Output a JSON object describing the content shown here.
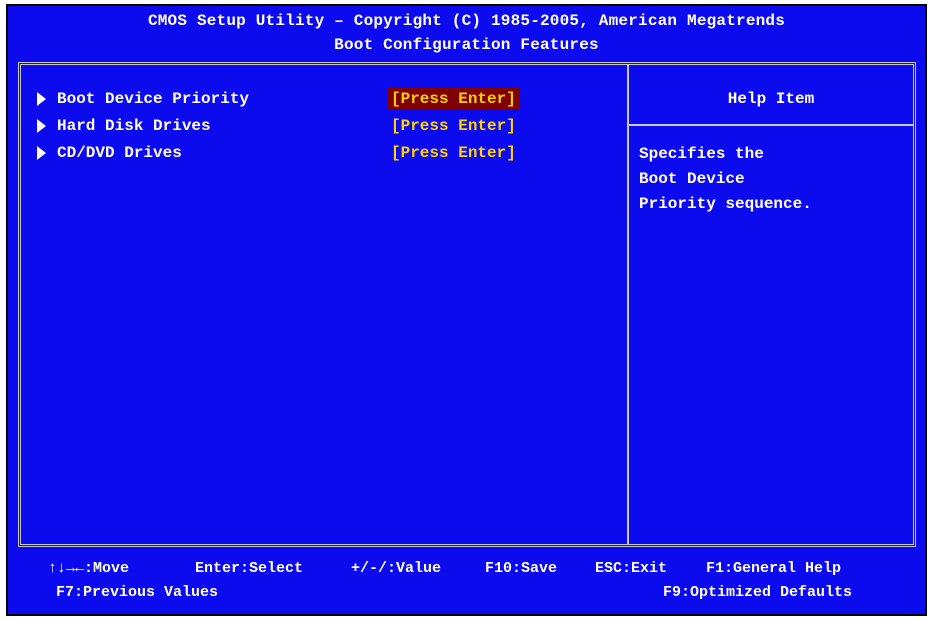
{
  "header": {
    "line1": "CMOS Setup Utility – Copyright (C) 1985-2005, American Megatrends",
    "line2": "Boot Configuration Features"
  },
  "items": [
    {
      "label": "Boot Device Priority",
      "value": "[Press Enter]",
      "selected": true
    },
    {
      "label": "Hard Disk Drives",
      "value": "[Press Enter]",
      "selected": false
    },
    {
      "label": "CD/DVD Drives",
      "value": "[Press Enter]",
      "selected": false
    }
  ],
  "help": {
    "title": "Help Item",
    "lines": [
      "Specifies the",
      "Boot Device",
      "Priority sequence."
    ]
  },
  "footer": {
    "move": "↑↓→←:Move",
    "select": "Enter:Select",
    "value": "+/-/:Value",
    "save": "F10:Save",
    "exit": "ESC:Exit",
    "general_help": "F1:General Help",
    "previous": "F7:Previous Values",
    "optimized": "F9:Optimized Defaults"
  },
  "colors": {
    "background": "#0b0bee",
    "text": "#ffffff",
    "value_text": "#ffd200",
    "selection": "#800000",
    "frame": "#c8c8c8"
  }
}
